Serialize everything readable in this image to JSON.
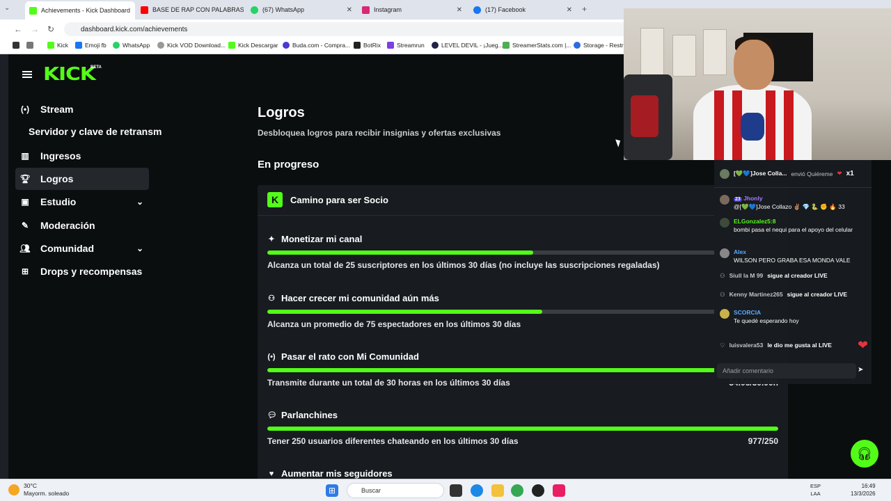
{
  "browser": {
    "tabs": [
      {
        "label": "Achievements - Kick Dashboard",
        "color": "#53fc18"
      },
      {
        "label": "BASE DE RAP CON PALABRAS 🔥",
        "color": "#ff0000"
      },
      {
        "label": "(67) WhatsApp",
        "color": "#25d366"
      },
      {
        "label": "Instagram",
        "color": "#d62976"
      },
      {
        "label": "(17) Facebook",
        "color": "#1877f2"
      }
    ],
    "url": "dashboard.kick.com/achievements",
    "bookmarks": [
      "Kick",
      "Emoji fb",
      "WhatsApp",
      "Kick VOD Download...",
      "Kick Descargar",
      "Buda.com - Compra...",
      "BotRix",
      "Streamrun",
      "LEVEL DEVIL - ¡Jueg...",
      "StreamerStats.com |...",
      "Storage - Restre"
    ]
  },
  "sidebar": {
    "logo": "KICK",
    "beta": "BETA",
    "items": [
      {
        "label": "Stream",
        "icon": "broadcast-icon"
      },
      {
        "label": "Servidor y clave de retransm"
      },
      {
        "label": "Ingresos",
        "icon": "chart-icon"
      },
      {
        "label": "Logros",
        "icon": "trophy-icon"
      },
      {
        "label": "Estudio",
        "icon": "studio-icon"
      },
      {
        "label": "Moderación",
        "icon": "wrench-icon"
      },
      {
        "label": "Comunidad",
        "icon": "community-icon"
      },
      {
        "label": "Drops y recompensas",
        "icon": "cake-icon"
      }
    ]
  },
  "main": {
    "title": "Logros",
    "subtitle": "Desbloquea logros para recibir insignias y ofertas exclusivas",
    "section": "En progreso",
    "card_title": "Camino para ser Socio",
    "achievements": [
      {
        "name": "Monetizar mi canal",
        "desc": "Alcanza un total de 25 suscriptores en los últimos 30 días (no incluye las suscripciones regaladas)",
        "value": "",
        "progress": 0.52
      },
      {
        "name": "Hacer crecer mi comunidad aún más",
        "desc": "Alcanza un promedio de 75 espectadores en los últimos 30 días",
        "value": "",
        "progress": 0.538
      },
      {
        "name": "Pasar el rato con Mi Comunidad",
        "desc": "Transmite durante un total de 30 horas en los últimos 30 días",
        "value": "34.06/30.00h",
        "progress": 1.0
      },
      {
        "name": "Parlanchines",
        "desc": "Tener 250 usuarios diferentes chateando en los últimos 30 días",
        "value": "977/250",
        "progress": 1.0
      },
      {
        "name": "Aumentar mis seguidores",
        "desc": "",
        "value": "",
        "progress": 0
      }
    ]
  },
  "chat": {
    "top_user": "[💚💙]Jose Colla...",
    "top_action": "envió Quiéreme",
    "top_count": "x1",
    "messages": [
      {
        "user": "Jhonly",
        "badge": "23",
        "text": "@[💚💙]Jose Collazo ✌🏽 💎 🐍 ✊ 🔥 33",
        "color": "#a77bff"
      },
      {
        "user": "ELGonzalez5:8",
        "text": "bombi pasa el nequi para el apoyo del celular",
        "color": "#53fc18"
      },
      {
        "user": "Alex",
        "text": "WILSON PERO GRABA ESA MONDA VALE",
        "color": "#5aa9ff"
      },
      {
        "user": "Siull la M 99",
        "text": "sigue al creador LIVE",
        "color": "#c0c4c9"
      },
      {
        "user": "Kenny Martinez265",
        "text": "sigue al creador LIVE",
        "color": "#c0c4c9"
      },
      {
        "user": "SCORCIA",
        "text": "Te quedé esperando hoy",
        "color": "#5aa9ff"
      },
      {
        "user": "luisvalera53",
        "text": "le dio me gusta al LIVE",
        "color": "#c0c4c9"
      }
    ],
    "placeholder": "Añadir comentario"
  },
  "taskbar": {
    "temp": "30°C",
    "weather": "Mayorm. soleado",
    "search": "Buscar",
    "lang1": "ESP",
    "lang2": "LAA",
    "time": "16:49",
    "date": "13/3/2026"
  },
  "colors": {
    "accent": "#53fc18",
    "card": "#181b1f",
    "bg": "#0b0e0f"
  }
}
